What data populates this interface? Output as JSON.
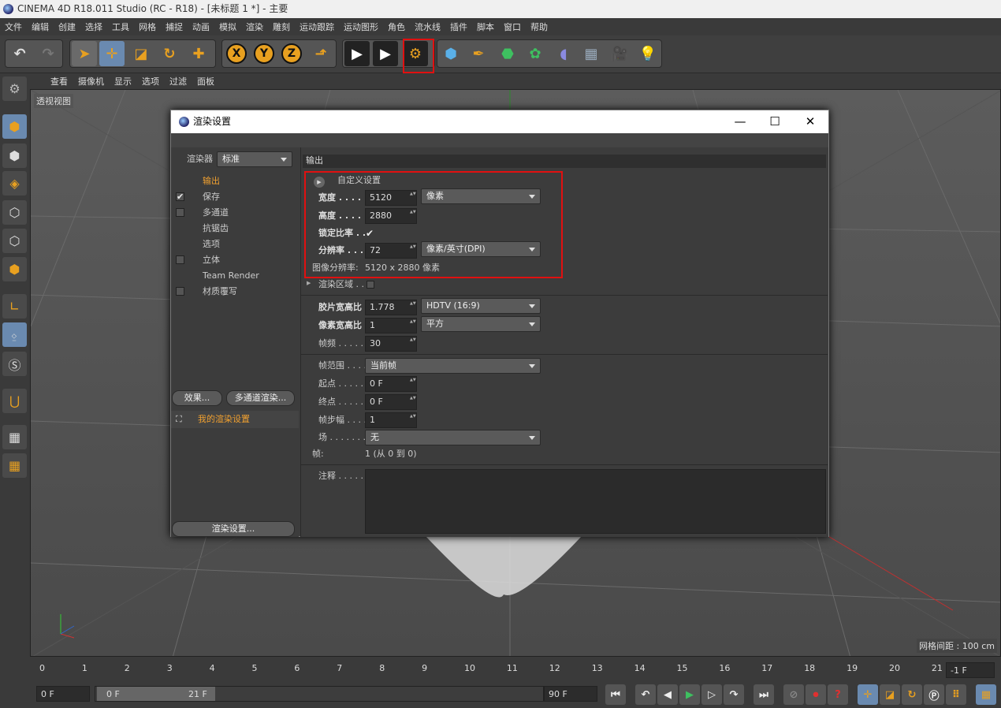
{
  "window": {
    "title": "CINEMA 4D R18.011 Studio (RC - R18) - [未标题 1 *] - 主要"
  },
  "menu": [
    "文件",
    "编辑",
    "创建",
    "选择",
    "工具",
    "网格",
    "捕捉",
    "动画",
    "模拟",
    "渲染",
    "雕刻",
    "运动跟踪",
    "运动图形",
    "角色",
    "流水线",
    "插件",
    "脚本",
    "窗口",
    "帮助"
  ],
  "toolbar": {
    "icons": [
      "undo-icon",
      "redo-icon",
      "select-icon",
      "move-icon",
      "scale-icon",
      "rotate-icon",
      "add-icon",
      "x-axis-icon",
      "y-axis-icon",
      "z-axis-icon",
      "coordinate-system-icon",
      "render-view-icon",
      "render-picture-viewer-icon",
      "render-settings-icon",
      "cube-icon",
      "pen-icon",
      "subdivision-icon",
      "cloner-icon",
      "deformer-icon",
      "floor-icon",
      "camera-icon",
      "light-icon"
    ],
    "axes": [
      "X",
      "Y",
      "Z"
    ]
  },
  "viewport": {
    "menu": [
      "查看",
      "摄像机",
      "显示",
      "选项",
      "过滤",
      "面板"
    ],
    "label": "透视视图",
    "grid_info": "网格间距 : 100 cm"
  },
  "timeline": {
    "ticks": [
      "0",
      "1",
      "2",
      "3",
      "4",
      "5",
      "6",
      "7",
      "8",
      "9",
      "10",
      "11",
      "12",
      "13",
      "14",
      "15",
      "16",
      "17",
      "18",
      "19",
      "20",
      "21"
    ],
    "current": "-1 F",
    "start": "0 F",
    "range_start": "0 F",
    "range_end": "21 F",
    "end": "90 F"
  },
  "dialog": {
    "title": "渲染设置",
    "renderer_label": "渲染器",
    "renderer_value": "标准",
    "nav": [
      {
        "label": "输出",
        "checked": false,
        "has_check": false,
        "active": true
      },
      {
        "label": "保存",
        "checked": true,
        "has_check": true,
        "active": false
      },
      {
        "label": "多通道",
        "checked": false,
        "has_check": true,
        "active": false
      },
      {
        "label": "抗锯齿",
        "checked": false,
        "has_check": false,
        "active": false
      },
      {
        "label": "选项",
        "checked": false,
        "has_check": false,
        "active": false
      },
      {
        "label": "立体",
        "checked": false,
        "has_check": true,
        "active": false
      },
      {
        "label": "Team Render",
        "checked": false,
        "has_check": false,
        "active": false
      },
      {
        "label": "材质覆写",
        "checked": false,
        "has_check": true,
        "active": false
      }
    ],
    "effects_button": "效果...",
    "multipass_button": "多通道渲染...",
    "my_settings": "我的渲染设置",
    "render_settings_button": "渲染设置...",
    "section_title": "输出",
    "preset": "自定义设置",
    "width_label": "宽度 . . . . .",
    "width_value": "5120",
    "unit_value": "像素",
    "height_label": "高度 . . . . .",
    "height_value": "2880",
    "lock_ratio_label": "锁定比率 . .",
    "resolution_label": "分辨率 . . . .",
    "resolution_value": "72",
    "resolution_unit": "像素/英寸(DPI)",
    "image_resolution_label": "图像分辨率:",
    "image_resolution_value": "5120 x 2880 像素",
    "render_region_label": "渲染区域 . .",
    "film_aspect_label": "胶片宽高比",
    "film_aspect_value": "1.778",
    "film_aspect_preset": "HDTV (16:9)",
    "pixel_aspect_label": "像素宽高比",
    "pixel_aspect_value": "1",
    "pixel_aspect_preset": "平方",
    "fps_label": "帧频 . . . . .",
    "fps_value": "30",
    "frame_range_label": "帧范围 . . . .",
    "frame_range_value": "当前帧",
    "start_label": "起点 . . . . . .",
    "start_value": "0 F",
    "end_label": "终点 . . . . . .",
    "end_value": "0 F",
    "frame_step_label": "帧步幅 . . . .",
    "frame_step_value": "1",
    "field_label": "场 . . . . . . .",
    "field_value": "无",
    "frames_label": "帧:",
    "frames_value": "1 (从 0 到 0)",
    "notes_label": "注释 . . . . ."
  },
  "colors": {
    "accent": "#f0a030",
    "highlight": "#e01010",
    "toolbar_icon": "#e8a020"
  }
}
